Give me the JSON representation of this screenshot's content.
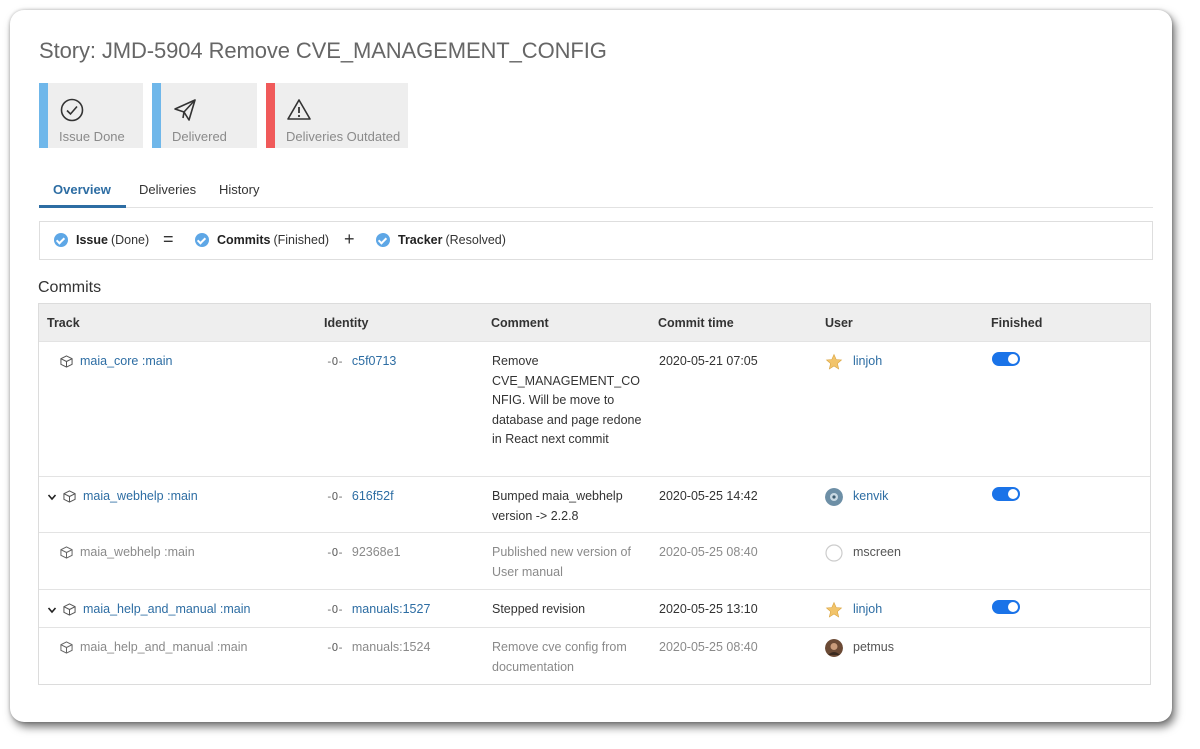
{
  "page": {
    "title": "Story: JMD-5904 Remove CVE_MANAGEMENT_CONFIG"
  },
  "badges": [
    {
      "label": "Issue Done",
      "icon": "check-circle-icon",
      "color": "#6fb7ea"
    },
    {
      "label": "Delivered",
      "icon": "paper-plane-icon",
      "color": "#6fb7ea"
    },
    {
      "label": "Deliveries Outdated",
      "icon": "warning-icon",
      "color": "#f05a5a"
    }
  ],
  "tabs": [
    {
      "label": "Overview",
      "active": true
    },
    {
      "label": "Deliveries",
      "active": false
    },
    {
      "label": "History",
      "active": false
    }
  ],
  "status": {
    "issue": {
      "name": "Issue",
      "state": "(Done)"
    },
    "eq": "=",
    "commits": {
      "name": "Commits",
      "state": "(Finished)"
    },
    "plus": "+",
    "tracker": {
      "name": "Tracker",
      "state": "(Resolved)"
    }
  },
  "commits": {
    "title": "Commits",
    "columns": [
      "Track",
      "Identity",
      "Comment",
      "Commit time",
      "User",
      "Finished"
    ],
    "rows": [
      {
        "track": "maia_core",
        "branch": ":main",
        "identity": "c5f0713",
        "comment": "Remove CVE_MANAGEMENT_CO NFIG. Will be move to database and page redone in React next commit",
        "time": "2020-05-21 07:05",
        "user": "linjoh",
        "finished": true,
        "sub": false,
        "expandable": false
      },
      {
        "track": "maia_webhelp",
        "branch": ":main",
        "identity": "616f52f",
        "comment": "Bumped maia_webhelp version -> 2.2.8",
        "time": "2020-05-25 14:42",
        "user": "kenvik",
        "finished": true,
        "sub": false,
        "expandable": true
      },
      {
        "track": "maia_webhelp",
        "branch": ":main",
        "identity": "92368e1",
        "comment": "Published new version of User manual",
        "time": "2020-05-25 08:40",
        "user": "mscreen",
        "finished": false,
        "sub": true,
        "expandable": false
      },
      {
        "track": "maia_help_and_manual",
        "branch": ":main",
        "identity": "manuals:1527",
        "comment": "Stepped revision",
        "time": "2020-05-25 13:10",
        "user": "linjoh",
        "finished": true,
        "sub": false,
        "expandable": true
      },
      {
        "track": "maia_help_and_manual",
        "branch": ":main",
        "identity": "manuals:1524",
        "comment": "Remove cve config from documentation",
        "time": "2020-05-25 08:40",
        "user": "petmus",
        "finished": false,
        "sub": true,
        "expandable": false
      }
    ]
  },
  "colors": {
    "accent": "#2d6da3",
    "toggle_on": "#1a73e8",
    "check": "#5ea7e6"
  }
}
